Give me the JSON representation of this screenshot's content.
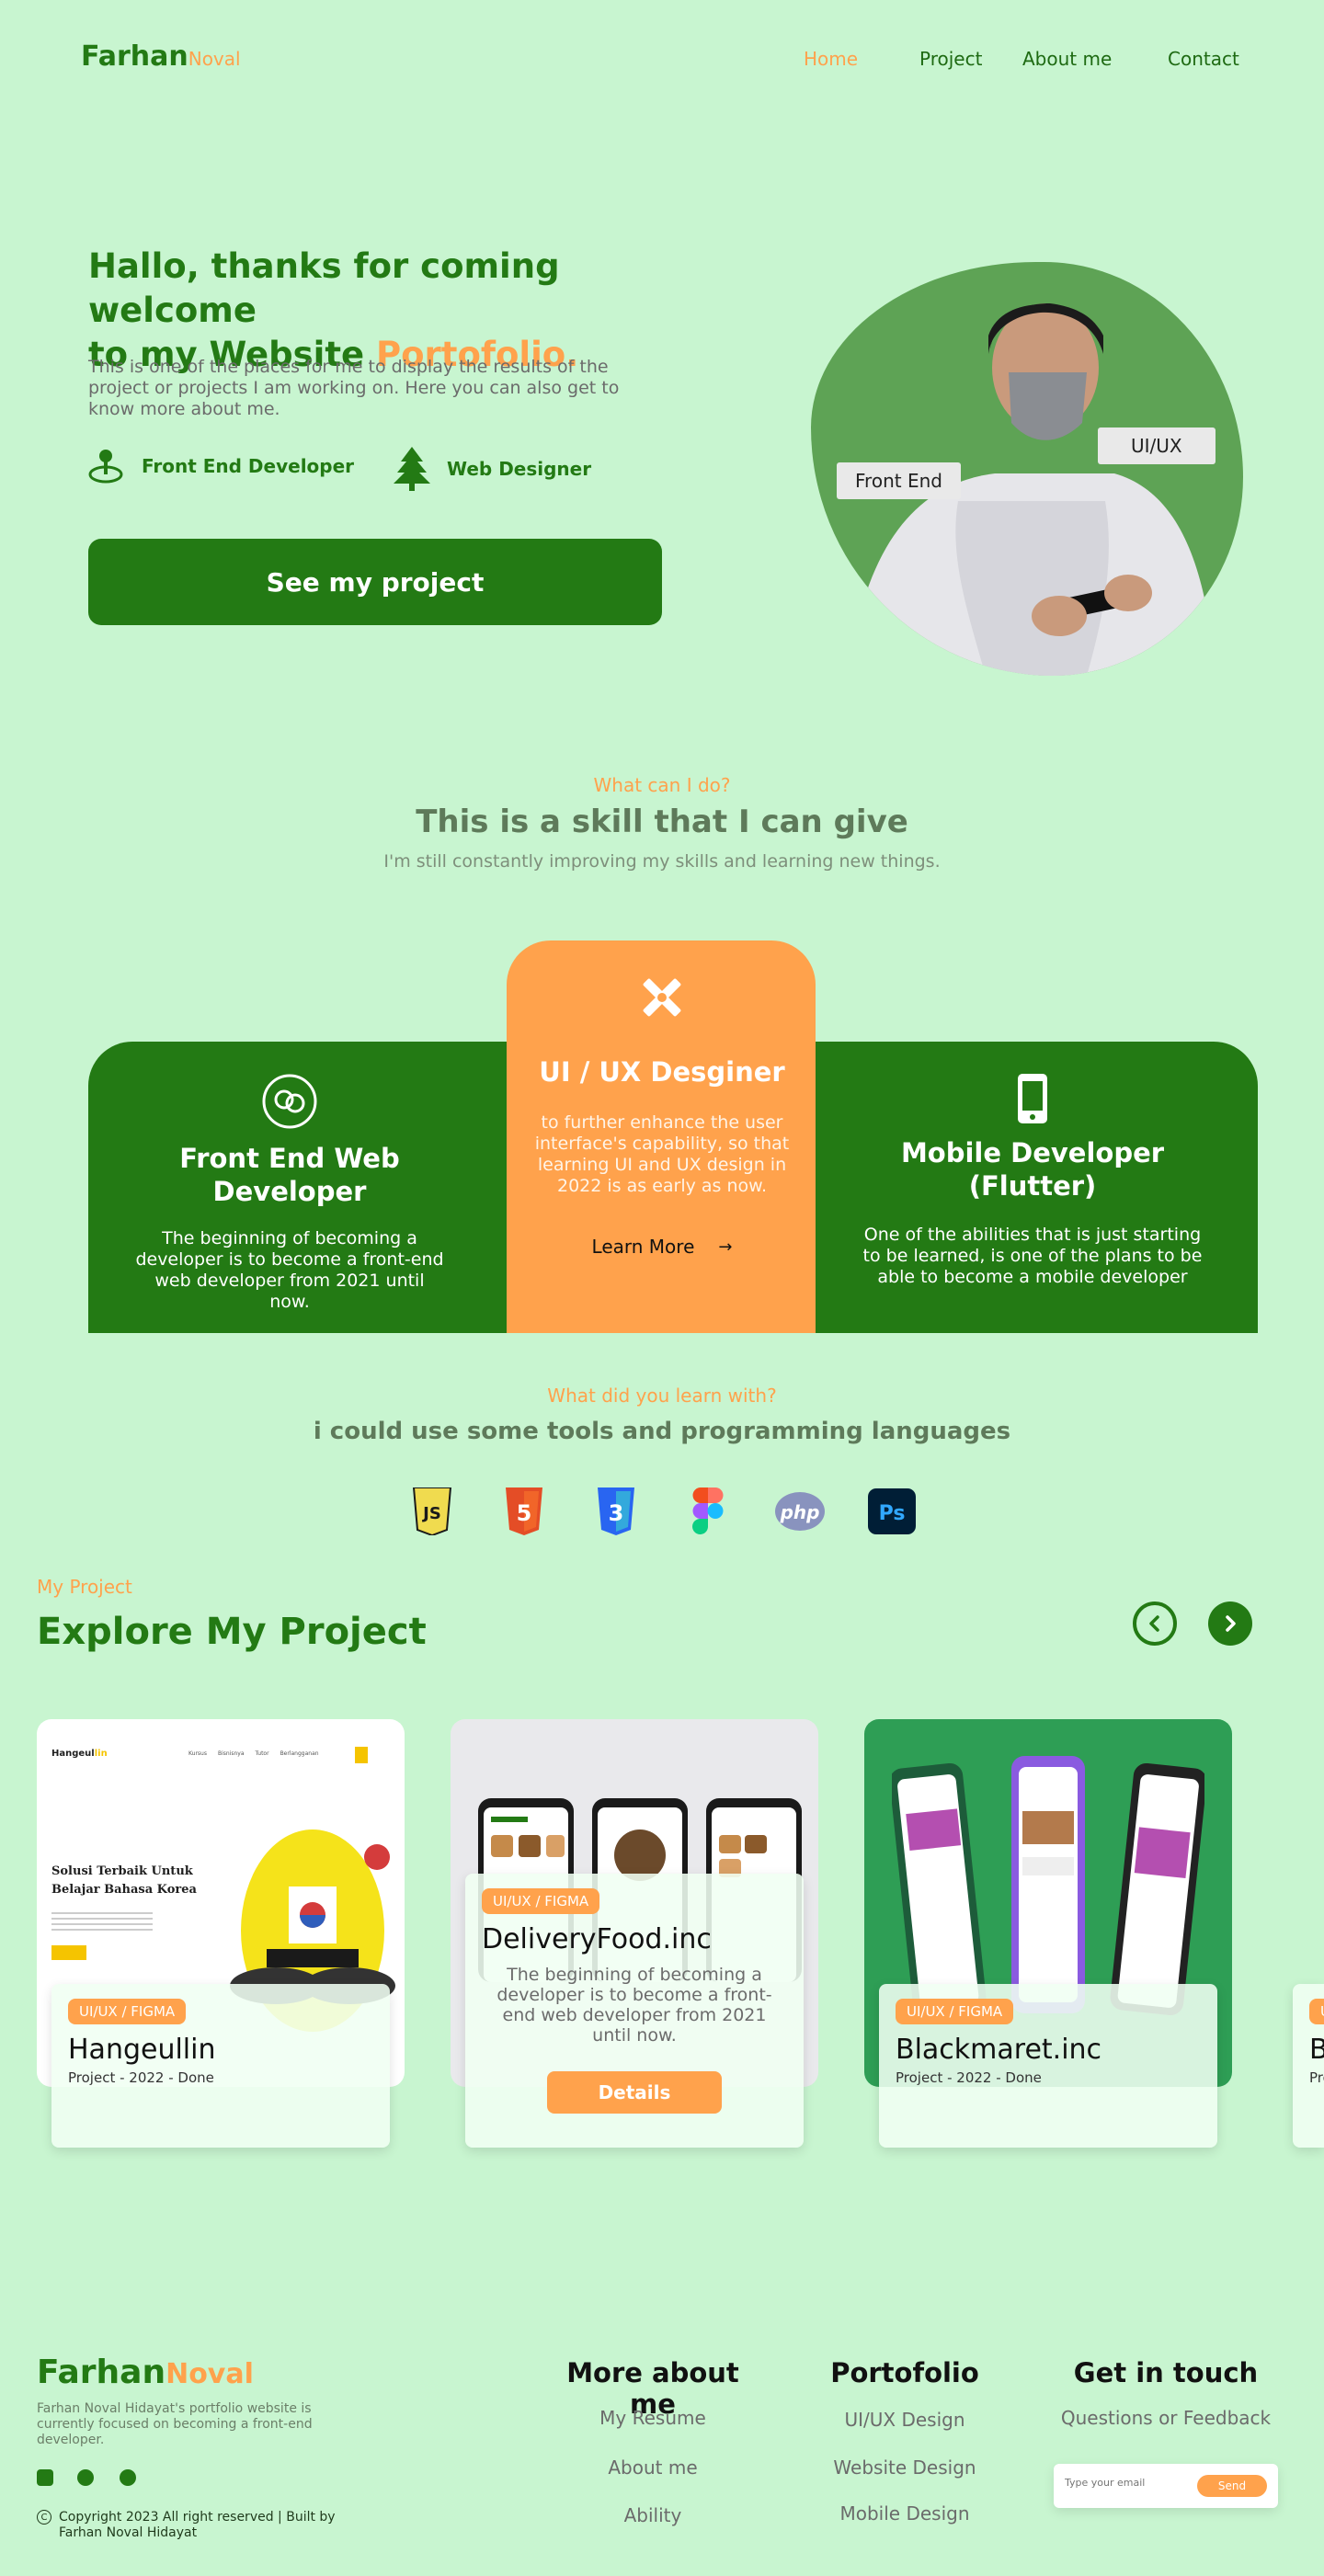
{
  "nav": {
    "logo_main": "Farhan",
    "logo_sub": "Noval",
    "links": [
      "Home",
      "Project",
      "About me",
      "Contact"
    ]
  },
  "hero": {
    "title_line1": "Hallo, thanks for coming welcome",
    "title_line2": "to my Website",
    "title_accent": "Portofolio.",
    "description": "This is one of the places for me to display the results of the project or projects I am working on. Here you can also get to know more about me.",
    "roles": [
      "Front End Developer",
      "Web Designer"
    ],
    "cta": "See my project",
    "tags": [
      "Front End",
      "UI/UX"
    ]
  },
  "skills": {
    "eyebrow": "What can I do?",
    "title": "This is a skill that I can give",
    "subtitle": "I'm still constantly improving my skills and learning new things.",
    "cards": [
      {
        "title": "Front End Web Developer",
        "text": "The beginning of becoming a developer is to become a front-end web developer from 2021 until now."
      },
      {
        "title": "UI / UX Desginer",
        "text": "to further enhance the user interface's capability, so that learning UI and UX design in 2022 is as early as now.",
        "link": "Learn More"
      },
      {
        "title": "Mobile Developer (Flutter)",
        "text": "One of the abilities that is just starting to be learned, is one of the plans to be able to become a mobile developer"
      }
    ]
  },
  "tools": {
    "eyebrow": "What did you learn with?",
    "title": "i could use some tools and programming languages",
    "items": [
      {
        "icon": "javascript-icon",
        "label": "JS",
        "color": "#f0db4f"
      },
      {
        "icon": "html5-icon",
        "label": "5",
        "color": "#e44d26"
      },
      {
        "icon": "css3-icon",
        "label": "3",
        "color": "#2965f1"
      },
      {
        "icon": "figma-icon",
        "label": "",
        "color": "#a259ff"
      },
      {
        "icon": "php-icon",
        "label": "php",
        "color": "#8993be"
      },
      {
        "icon": "photoshop-icon",
        "label": "Ps",
        "color": "#001e36"
      }
    ]
  },
  "projects": {
    "eyebrow": "My Project",
    "title": "Explore My Project",
    "items": [
      {
        "badge": "UI/UX / FIGMA",
        "name": "Hangeullin",
        "meta": "Project - 2022 - Done",
        "screen_title": "Solusi Terbaik Untuk Belajar Bahasa Korea"
      },
      {
        "badge": "UI/UX / FIGMA",
        "name": "DeliveryFood.inc",
        "description": "The beginning of becoming a developer is to become a front-end web developer from 2021 until now.",
        "button": "Details"
      },
      {
        "badge": "UI/UX / FIGMA",
        "name": "Blackmaret.inc",
        "meta": "Project - 2022 - Done"
      },
      {
        "badge": "U",
        "name": "B",
        "meta": "Pro"
      }
    ]
  },
  "footer": {
    "logo_main": "Farhan",
    "logo_sub": "Noval",
    "description": "Farhan Noval Hidayat's portfolio website is currently focused on becoming a front-end developer.",
    "copyright": "Copyright 2023 All right reserved | Built by Farhan Noval Hidayat",
    "col1": {
      "title": "More about me",
      "links": [
        "My Resume",
        "About me",
        "Ability"
      ]
    },
    "col2": {
      "title": "Portofolio",
      "links": [
        "UI/UX Design",
        "Website Design",
        "Mobile Design"
      ]
    },
    "col3": {
      "title": "Get in touch",
      "link": "Questions or Feedback",
      "placeholder": "Type your email",
      "send": "Send"
    }
  }
}
